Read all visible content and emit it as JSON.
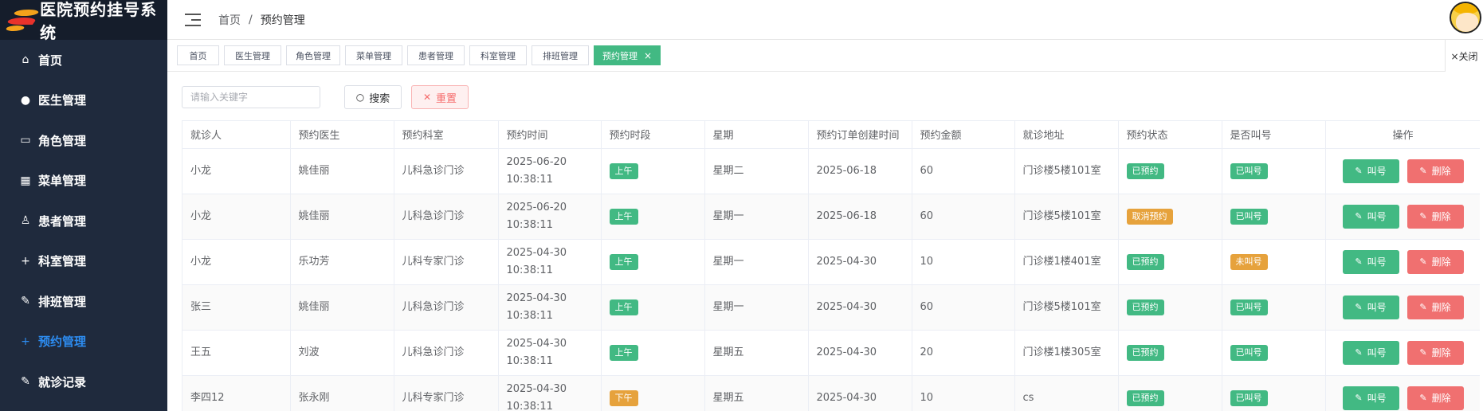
{
  "app": {
    "title": "医院预约挂号系统"
  },
  "sidebar": {
    "items": [
      {
        "label": "首页",
        "icon": "home-icon",
        "glyph": "⌂",
        "active": false
      },
      {
        "label": "医生管理",
        "icon": "user-icon",
        "glyph": "●",
        "active": false
      },
      {
        "label": "角色管理",
        "icon": "folder-icon",
        "glyph": "▭",
        "active": false
      },
      {
        "label": "菜单管理",
        "icon": "grid-icon",
        "glyph": "▦",
        "active": false
      },
      {
        "label": "患者管理",
        "icon": "person-outline-icon",
        "glyph": "♙",
        "active": false
      },
      {
        "label": "科室管理",
        "icon": "plus-icon",
        "glyph": "+",
        "active": false
      },
      {
        "label": "排班管理",
        "icon": "edit-icon",
        "glyph": "✎",
        "active": false
      },
      {
        "label": "预约管理",
        "icon": "plus-icon",
        "glyph": "+",
        "active": true
      },
      {
        "label": "就诊记录",
        "icon": "edit-icon",
        "glyph": "✎",
        "active": false
      }
    ]
  },
  "header": {
    "breadcrumb": {
      "home": "首页",
      "separator": "/",
      "current": "预约管理"
    }
  },
  "tabs": {
    "items": [
      {
        "label": "首页",
        "active": false
      },
      {
        "label": "医生管理",
        "active": false
      },
      {
        "label": "角色管理",
        "active": false
      },
      {
        "label": "菜单管理",
        "active": false
      },
      {
        "label": "患者管理",
        "active": false
      },
      {
        "label": "科室管理",
        "active": false
      },
      {
        "label": "排班管理",
        "active": false
      },
      {
        "label": "预约管理",
        "active": true
      }
    ],
    "close_all_label": "×关闭"
  },
  "toolbar": {
    "search_placeholder": "请输入关键字",
    "search_label": "搜索",
    "reset_label": "重置"
  },
  "table": {
    "columns": [
      "就诊人",
      "预约医生",
      "预约科室",
      "预约时间",
      "预约时段",
      "星期",
      "预约订单创建时间",
      "预约金额",
      "就诊地址",
      "预约状态",
      "是否叫号",
      "操作"
    ],
    "call_label": "叫号",
    "delete_label": "删除",
    "rows": [
      {
        "patient": "小龙",
        "doctor": "姚佳丽",
        "dept": "儿科急诊门诊",
        "time": "2025-06-20 10:38:11",
        "period": "上午",
        "period_color": "green",
        "weekday": "星期二",
        "created": "2025-06-18",
        "amount": "60",
        "address": "门诊楼5楼101室",
        "status": "已预约",
        "status_color": "green",
        "called": "已叫号",
        "called_color": "green"
      },
      {
        "patient": "小龙",
        "doctor": "姚佳丽",
        "dept": "儿科急诊门诊",
        "time": "2025-06-20 10:38:11",
        "period": "上午",
        "period_color": "green",
        "weekday": "星期一",
        "created": "2025-06-18",
        "amount": "60",
        "address": "门诊楼5楼101室",
        "status": "取消预约",
        "status_color": "orange",
        "called": "已叫号",
        "called_color": "green"
      },
      {
        "patient": "小龙",
        "doctor": "乐功芳",
        "dept": "儿科专家门诊",
        "time": "2025-04-30 10:38:11",
        "period": "上午",
        "period_color": "green",
        "weekday": "星期一",
        "created": "2025-04-30",
        "amount": "10",
        "address": "门诊楼1楼401室",
        "status": "已预约",
        "status_color": "green",
        "called": "未叫号",
        "called_color": "orange"
      },
      {
        "patient": "张三",
        "doctor": "姚佳丽",
        "dept": "儿科急诊门诊",
        "time": "2025-04-30 10:38:11",
        "period": "上午",
        "period_color": "green",
        "weekday": "星期一",
        "created": "2025-04-30",
        "amount": "60",
        "address": "门诊楼5楼101室",
        "status": "已预约",
        "status_color": "green",
        "called": "已叫号",
        "called_color": "green"
      },
      {
        "patient": "王五",
        "doctor": "刘波",
        "dept": "儿科急诊门诊",
        "time": "2025-04-30 10:38:11",
        "period": "上午",
        "period_color": "green",
        "weekday": "星期五",
        "created": "2025-04-30",
        "amount": "20",
        "address": "门诊楼1楼305室",
        "status": "已预约",
        "status_color": "green",
        "called": "已叫号",
        "called_color": "green"
      },
      {
        "patient": "李四12",
        "doctor": "张永刚",
        "dept": "儿科专家门诊",
        "time": "2025-04-30 10:38:11",
        "period": "下午",
        "period_color": "orange",
        "weekday": "星期五",
        "created": "2025-04-30",
        "amount": "10",
        "address": "cs",
        "status": "已预约",
        "status_color": "green",
        "called": "已叫号",
        "called_color": "green"
      }
    ]
  }
}
